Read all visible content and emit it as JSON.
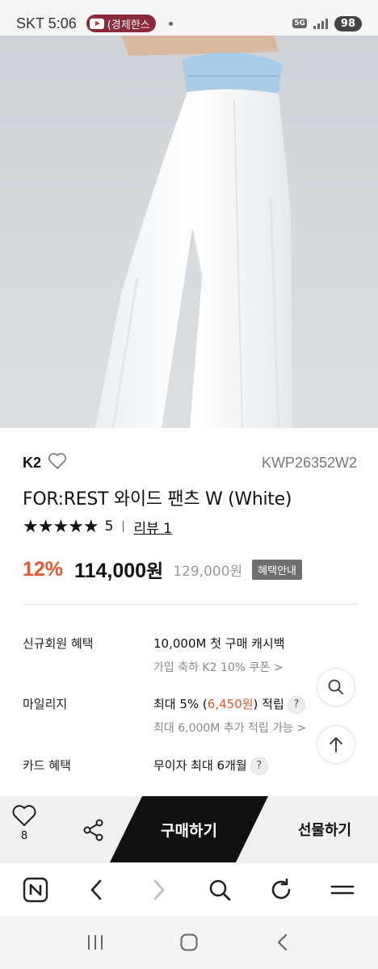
{
  "status_bar": {
    "carrier_time": "SKT 5:06",
    "app_badge": "(경제한스",
    "network": "5G",
    "battery": "98"
  },
  "product": {
    "brand": "K2",
    "code": "KWP26352W2",
    "title": "FOR:REST 와이드 팬츠 W (White)",
    "stars": "★★★★★",
    "rating": "5",
    "review_link": "리뷰 1",
    "discount": "12%",
    "price": "114,000",
    "price_unit": "원",
    "original_price": "129,000원",
    "benefit_button": "혜택안내"
  },
  "benefits": {
    "new_member": {
      "label": "신규회원 혜택",
      "main": "10,000M 첫 구매 캐시백",
      "sub": "가입 축하 K2 10% 쿠폰 >"
    },
    "mileage": {
      "label": "마일리지",
      "main_prefix": "최대 5% (",
      "main_highlight": "6,450원",
      "main_suffix": ") 적립",
      "sub": "최대 6,000M 추가 적립 가능 >"
    },
    "card": {
      "label": "카드 혜택",
      "main": "무이자 최대 6개월"
    },
    "help": "?"
  },
  "purchase_bar": {
    "like_count": "8",
    "buy_label": "구매하기",
    "gift_label": "선물하기"
  },
  "icons": {
    "heart": "heart-icon",
    "share": "share-icon",
    "search": "search-icon",
    "scroll_top": "arrow-up-icon",
    "naver": "naver-n-icon",
    "back": "chevron-left-icon",
    "forward": "chevron-right-icon",
    "reload": "reload-icon",
    "menu": "hamburger-icon"
  },
  "colors": {
    "accent": "#e4572e",
    "buy_button": "#111111",
    "benefit_button": "#6f6f6f"
  }
}
